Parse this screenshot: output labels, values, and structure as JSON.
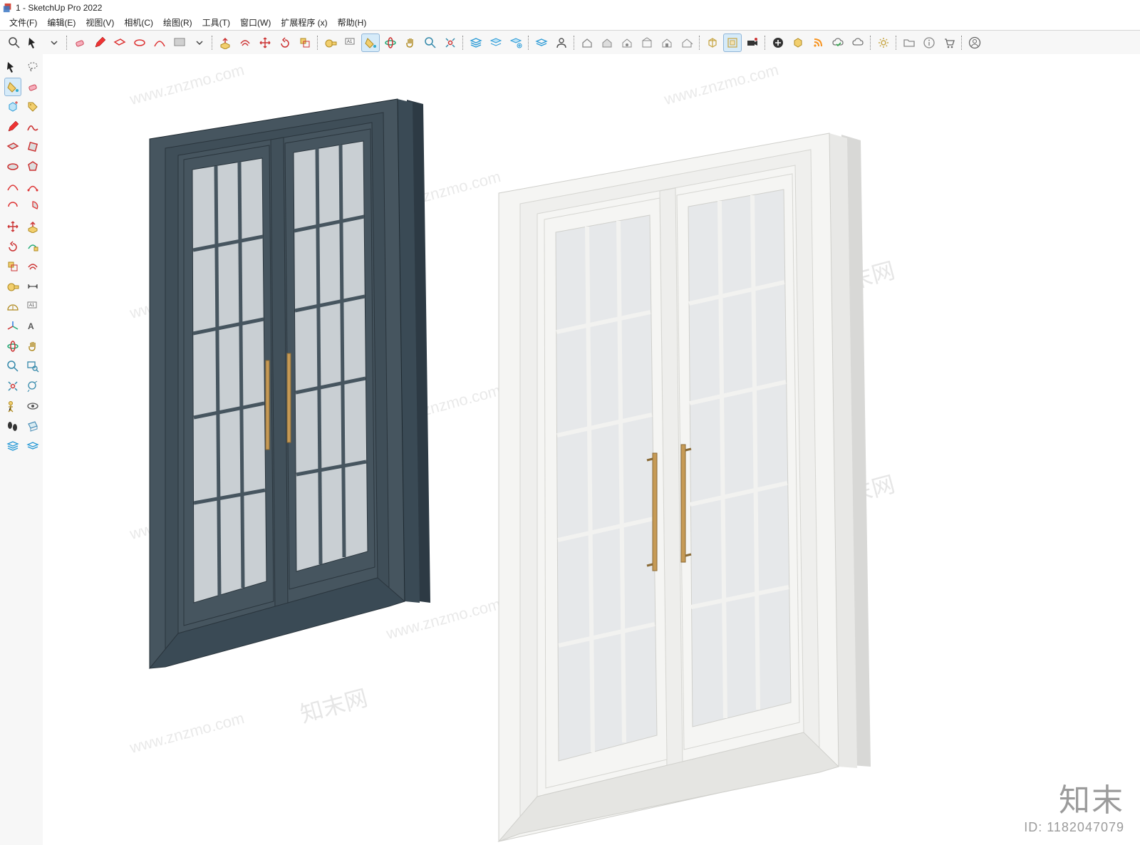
{
  "title": {
    "doc": "1",
    "app": "SketchUp Pro 2022"
  },
  "menu": {
    "file": "文件(F)",
    "edit": "编辑(E)",
    "view": "视图(V)",
    "camera": "相机(C)",
    "draw": "绘图(R)",
    "tools": "工具(T)",
    "window": "窗口(W)",
    "extensions": "扩展程序 (x)",
    "help": "帮助(H)"
  },
  "watermark": {
    "url": "www.znzmo.com",
    "cn": "知末网"
  },
  "brand": {
    "cn": "知末",
    "id": "ID: 1182047079"
  }
}
